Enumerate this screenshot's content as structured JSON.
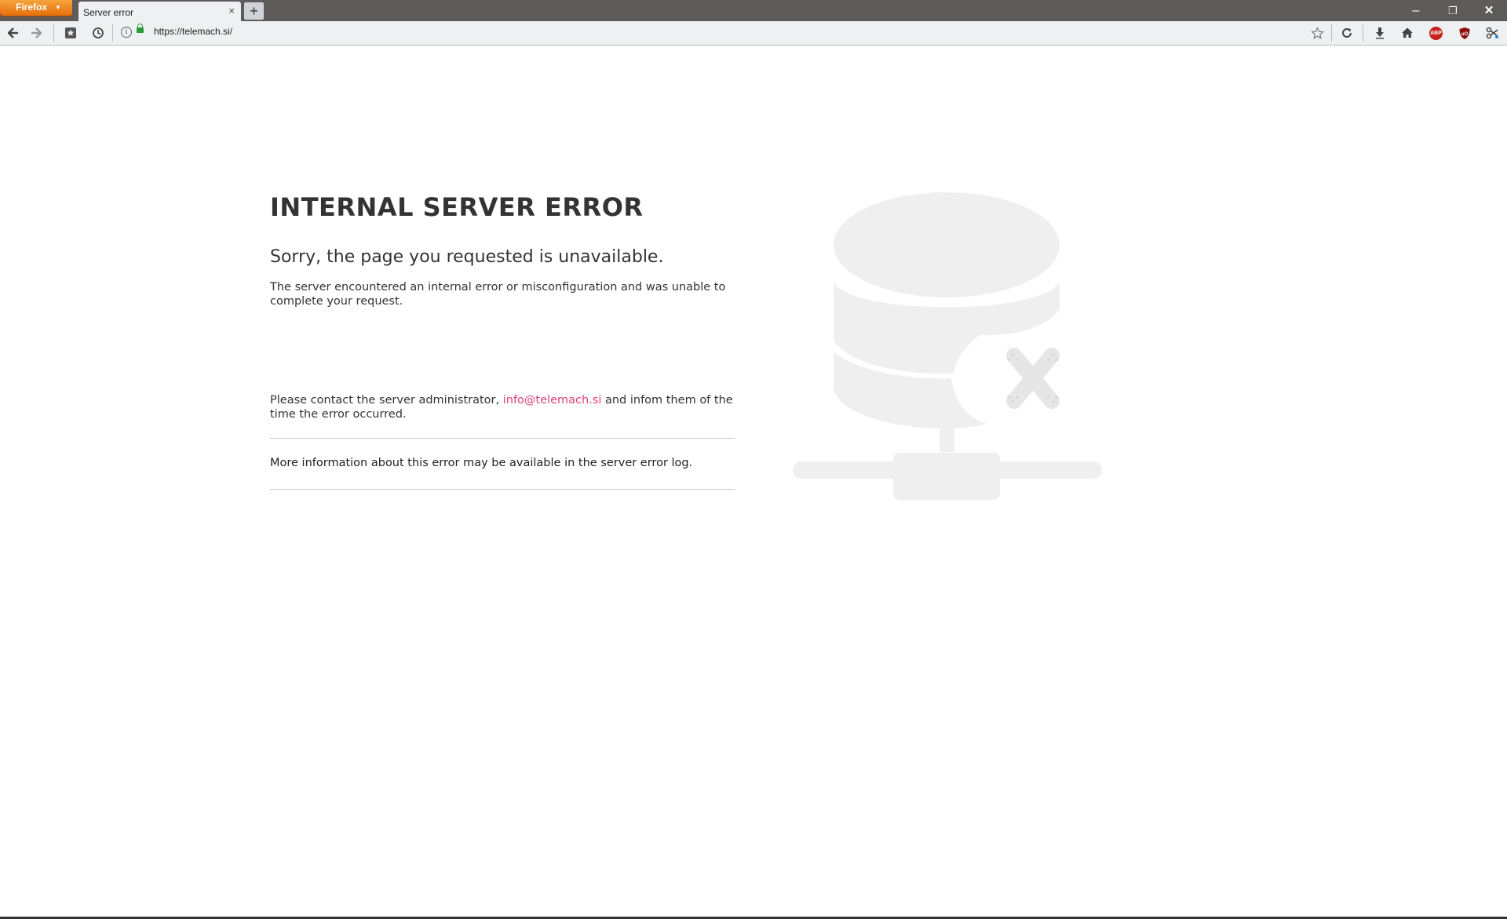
{
  "browser": {
    "menu_label": "Firefox",
    "tab_title": "Server error",
    "tab_close": "×",
    "new_tab": "+",
    "url": "https://telemach.si/",
    "abp_label": "ABP",
    "window_controls": {
      "minimize": "–",
      "maximize": "❐",
      "close": "✕"
    }
  },
  "page": {
    "heading": "INTERNAL SERVER ERROR",
    "subheading": "Sorry, the page you requested is unavailable.",
    "description": "The server encountered an internal error or misconfiguration and was unable to complete your request.",
    "contact_prefix": "Please contact the server administrator, ",
    "contact_email": "info@telemach.si",
    "contact_suffix": " and infom them of the time the error occurred.",
    "more_info": "More information about this error may be available in the server error log."
  },
  "colors": {
    "link": "#e0407b",
    "illustration": "#efefef",
    "firefox_orange": "#e46f0c"
  },
  "icons": {
    "back": "arrow-left",
    "forward": "arrow-right",
    "bookmarks": "star-box",
    "history": "clock",
    "star": "star-outline",
    "reload": "reload",
    "download": "arrow-down",
    "home": "house",
    "ublock": "shield",
    "tools": "scissors"
  }
}
